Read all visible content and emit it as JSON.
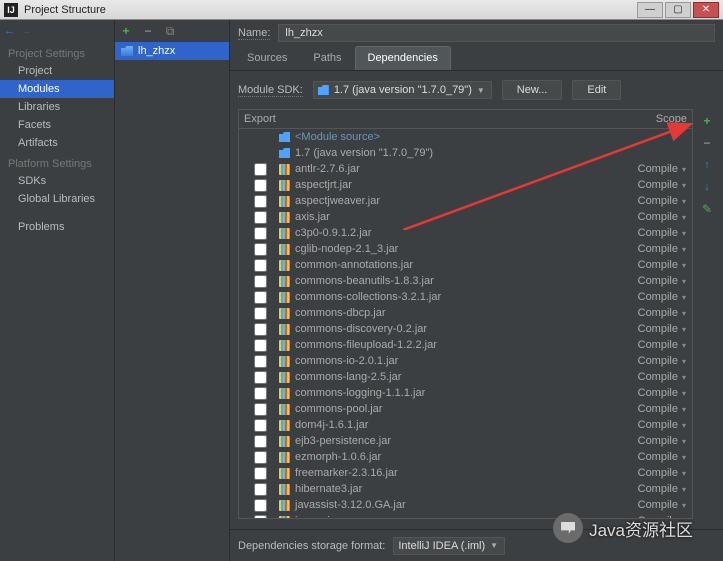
{
  "titlebar": {
    "title": "Project Structure"
  },
  "sidebar": {
    "heading1": "Project Settings",
    "items1": [
      "Project",
      "Modules",
      "Libraries",
      "Facets",
      "Artifacts"
    ],
    "heading2": "Platform Settings",
    "items2": [
      "SDKs",
      "Global Libraries"
    ],
    "heading3": "",
    "items3": [
      "Problems"
    ]
  },
  "tree": {
    "module_name": "lh_zhzx"
  },
  "content": {
    "name_label": "Name:",
    "name_value": "lh_zhzx",
    "tabs": [
      "Sources",
      "Paths",
      "Dependencies"
    ],
    "sdk_label": "Module SDK:",
    "sdk_value": "1.7 (java version \"1.7.0_79\")",
    "new_btn": "New...",
    "edit_btn": "Edit",
    "header_export": "Export",
    "header_scope": "Scope",
    "module_source": "<Module source>",
    "jdk_row": "1.7 (java version \"1.7.0_79\")",
    "deps": [
      {
        "name": "antlr-2.7.6.jar",
        "scope": "Compile"
      },
      {
        "name": "aspectjrt.jar",
        "scope": "Compile"
      },
      {
        "name": "aspectjweaver.jar",
        "scope": "Compile"
      },
      {
        "name": "axis.jar",
        "scope": "Compile"
      },
      {
        "name": "c3p0-0.9.1.2.jar",
        "scope": "Compile"
      },
      {
        "name": "cglib-nodep-2.1_3.jar",
        "scope": "Compile"
      },
      {
        "name": "common-annotations.jar",
        "scope": "Compile"
      },
      {
        "name": "commons-beanutils-1.8.3.jar",
        "scope": "Compile"
      },
      {
        "name": "commons-collections-3.2.1.jar",
        "scope": "Compile"
      },
      {
        "name": "commons-dbcp.jar",
        "scope": "Compile"
      },
      {
        "name": "commons-discovery-0.2.jar",
        "scope": "Compile"
      },
      {
        "name": "commons-fileupload-1.2.2.jar",
        "scope": "Compile"
      },
      {
        "name": "commons-io-2.0.1.jar",
        "scope": "Compile"
      },
      {
        "name": "commons-lang-2.5.jar",
        "scope": "Compile"
      },
      {
        "name": "commons-logging-1.1.1.jar",
        "scope": "Compile"
      },
      {
        "name": "commons-pool.jar",
        "scope": "Compile"
      },
      {
        "name": "dom4j-1.6.1.jar",
        "scope": "Compile"
      },
      {
        "name": "ejb3-persistence.jar",
        "scope": "Compile"
      },
      {
        "name": "ezmorph-1.0.6.jar",
        "scope": "Compile"
      },
      {
        "name": "freemarker-2.3.16.jar",
        "scope": "Compile"
      },
      {
        "name": "hibernate3.jar",
        "scope": "Compile"
      },
      {
        "name": "javassist-3.12.0.GA.jar",
        "scope": "Compile"
      },
      {
        "name": "jaxrpc.jar",
        "scope": "Compile"
      }
    ],
    "storage_label": "Dependencies storage format:",
    "storage_value": "IntelliJ IDEA (.iml)"
  },
  "watermark": "Java资源社区"
}
